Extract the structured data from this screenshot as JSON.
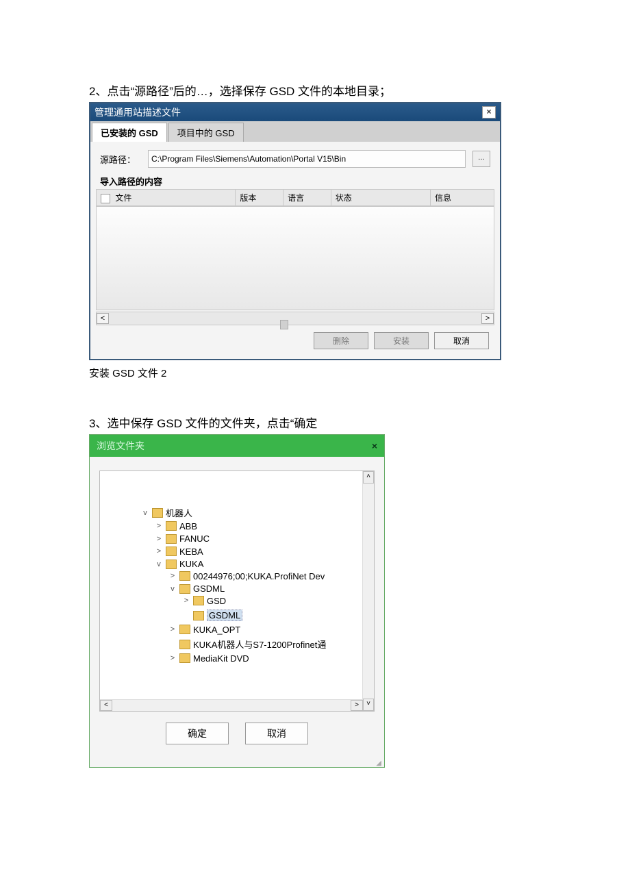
{
  "step2": {
    "text": "2、点击“源路径”后的…，选择保存 GSD 文件的本地目录；"
  },
  "dialog1": {
    "title": "管理通用站描述文件",
    "tabs": {
      "installed": "已安装的 GSD",
      "project": "项目中的 GSD"
    },
    "source_label": "源路径：",
    "source_value": "C:\\Program Files\\Siemens\\Automation\\Portal V15\\Bin",
    "browse_glyph": "…",
    "import_section": "导入路径的内容",
    "cols": {
      "file": "文件",
      "version": "版本",
      "language": "语言",
      "status": "状态",
      "info": "信息"
    },
    "buttons": {
      "delete": "删除",
      "install": "安装",
      "cancel": "取消"
    },
    "close_glyph": "×"
  },
  "caption2": "安装 GSD 文件 2",
  "step3": {
    "text": "3、选中保存 GSD 文件的文件夹，点击“确定"
  },
  "dialog2": {
    "title": "浏览文件夹",
    "close_glyph": "×",
    "buttons": {
      "ok": "确定",
      "cancel": "取消"
    },
    "tree": {
      "root": "机器人",
      "abb": "ABB",
      "fanuc": "FANUC",
      "keba": "KEBA",
      "kuka": "KUKA",
      "kuka_sub1": "00244976;00;KUKA.ProfiNet Dev",
      "gsdml": "GSDML",
      "gsd": "GSD",
      "gsdml_sel": "GSDML",
      "kuka_opt": "KUKA_OPT",
      "kuka_s7": "KUKA机器人与S7-1200Profinet通",
      "mediakit": "MediaKit DVD"
    },
    "expander": {
      "down": "v",
      "right": ">"
    },
    "scroll": {
      "up": "˄",
      "down": "˅",
      "left": "<",
      "right": ">"
    }
  }
}
